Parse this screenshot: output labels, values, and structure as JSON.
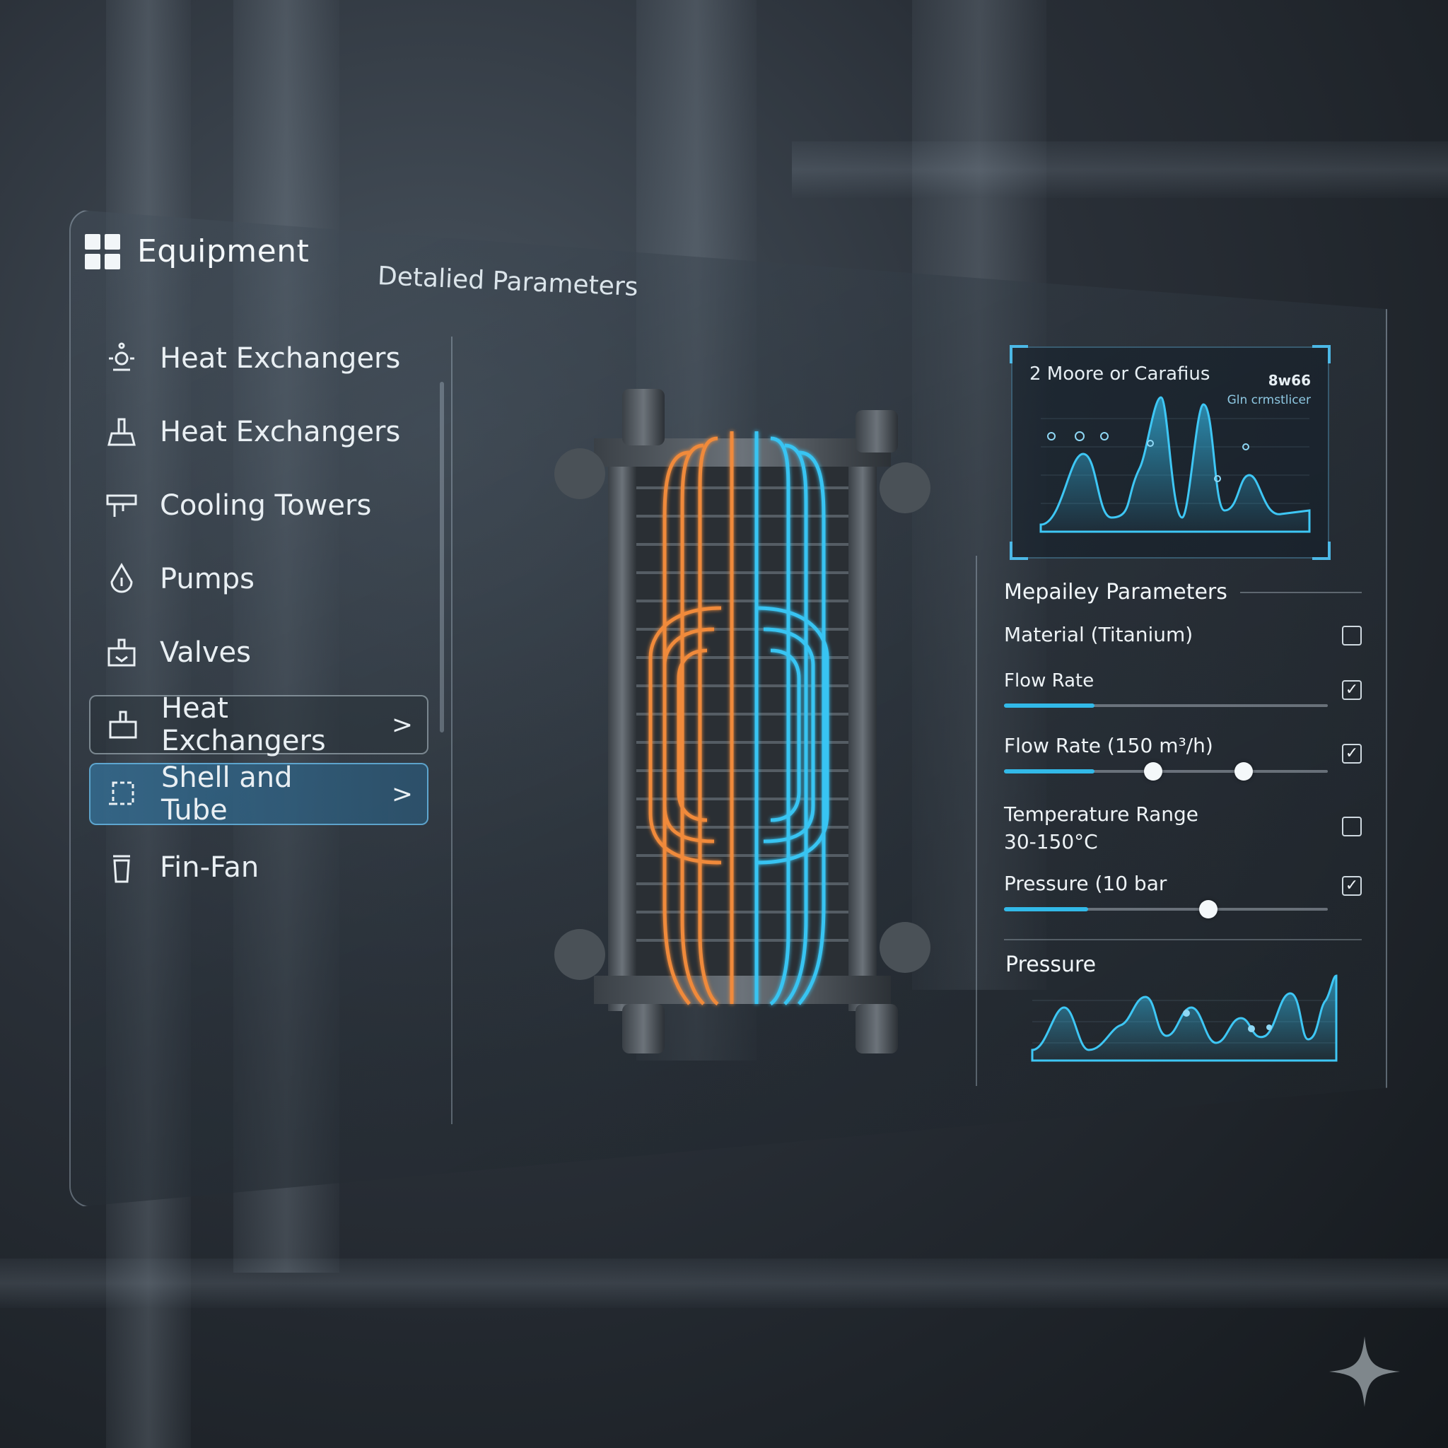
{
  "sidebar": {
    "title": "Equipment",
    "items": [
      {
        "label": "Heat Exchangers",
        "icon": "gear-valve-icon"
      },
      {
        "label": "Heat Exchangers",
        "icon": "tank-icon"
      },
      {
        "label": "Cooling Towers",
        "icon": "tower-icon"
      },
      {
        "label": "Pumps",
        "icon": "drop-icon"
      },
      {
        "label": "Valves",
        "icon": "valve-icon"
      },
      {
        "label": "Heat Exchangers",
        "icon": "exchanger-icon",
        "chevron": ">"
      },
      {
        "label": "Shell and Tube",
        "icon": "shell-tube-icon",
        "chevron": ">"
      },
      {
        "label": "Fin-Fan",
        "icon": "fan-icon"
      }
    ],
    "selected_index": 6
  },
  "main": {
    "title": "Detalied Parameters"
  },
  "right_panel": {
    "chart_top": {
      "title": "2 Moore or Carafius",
      "badge": "8w66",
      "subtitle": "Gln crmstlicer"
    },
    "params": {
      "title": "Mepailey Parameters",
      "rows": [
        {
          "label": "Material (Titanium)",
          "control": "toggle",
          "checked": false
        },
        {
          "label": "Flow Rate",
          "control": "slider",
          "fill": 0.28,
          "checked": true
        },
        {
          "label": "Flow Rate (150 m³/h)",
          "control": "range",
          "fill": 0.28,
          "knob_a": 0.46,
          "knob_b": 0.74,
          "checked": true
        },
        {
          "label": "Temperature Range",
          "value": "30-150°C",
          "control": "toggle",
          "checked": false
        },
        {
          "label": "Pressure (10 bar",
          "control": "slider",
          "fill": 0.26,
          "knob_a": 0.63,
          "checked": true
        }
      ],
      "check_glyph": "✓"
    },
    "chart_bottom": {
      "title": "Pressure"
    }
  },
  "colors": {
    "accent": "#32b9e8",
    "hot": "#f07a2e",
    "selected_bg": "#2f6a8e"
  }
}
